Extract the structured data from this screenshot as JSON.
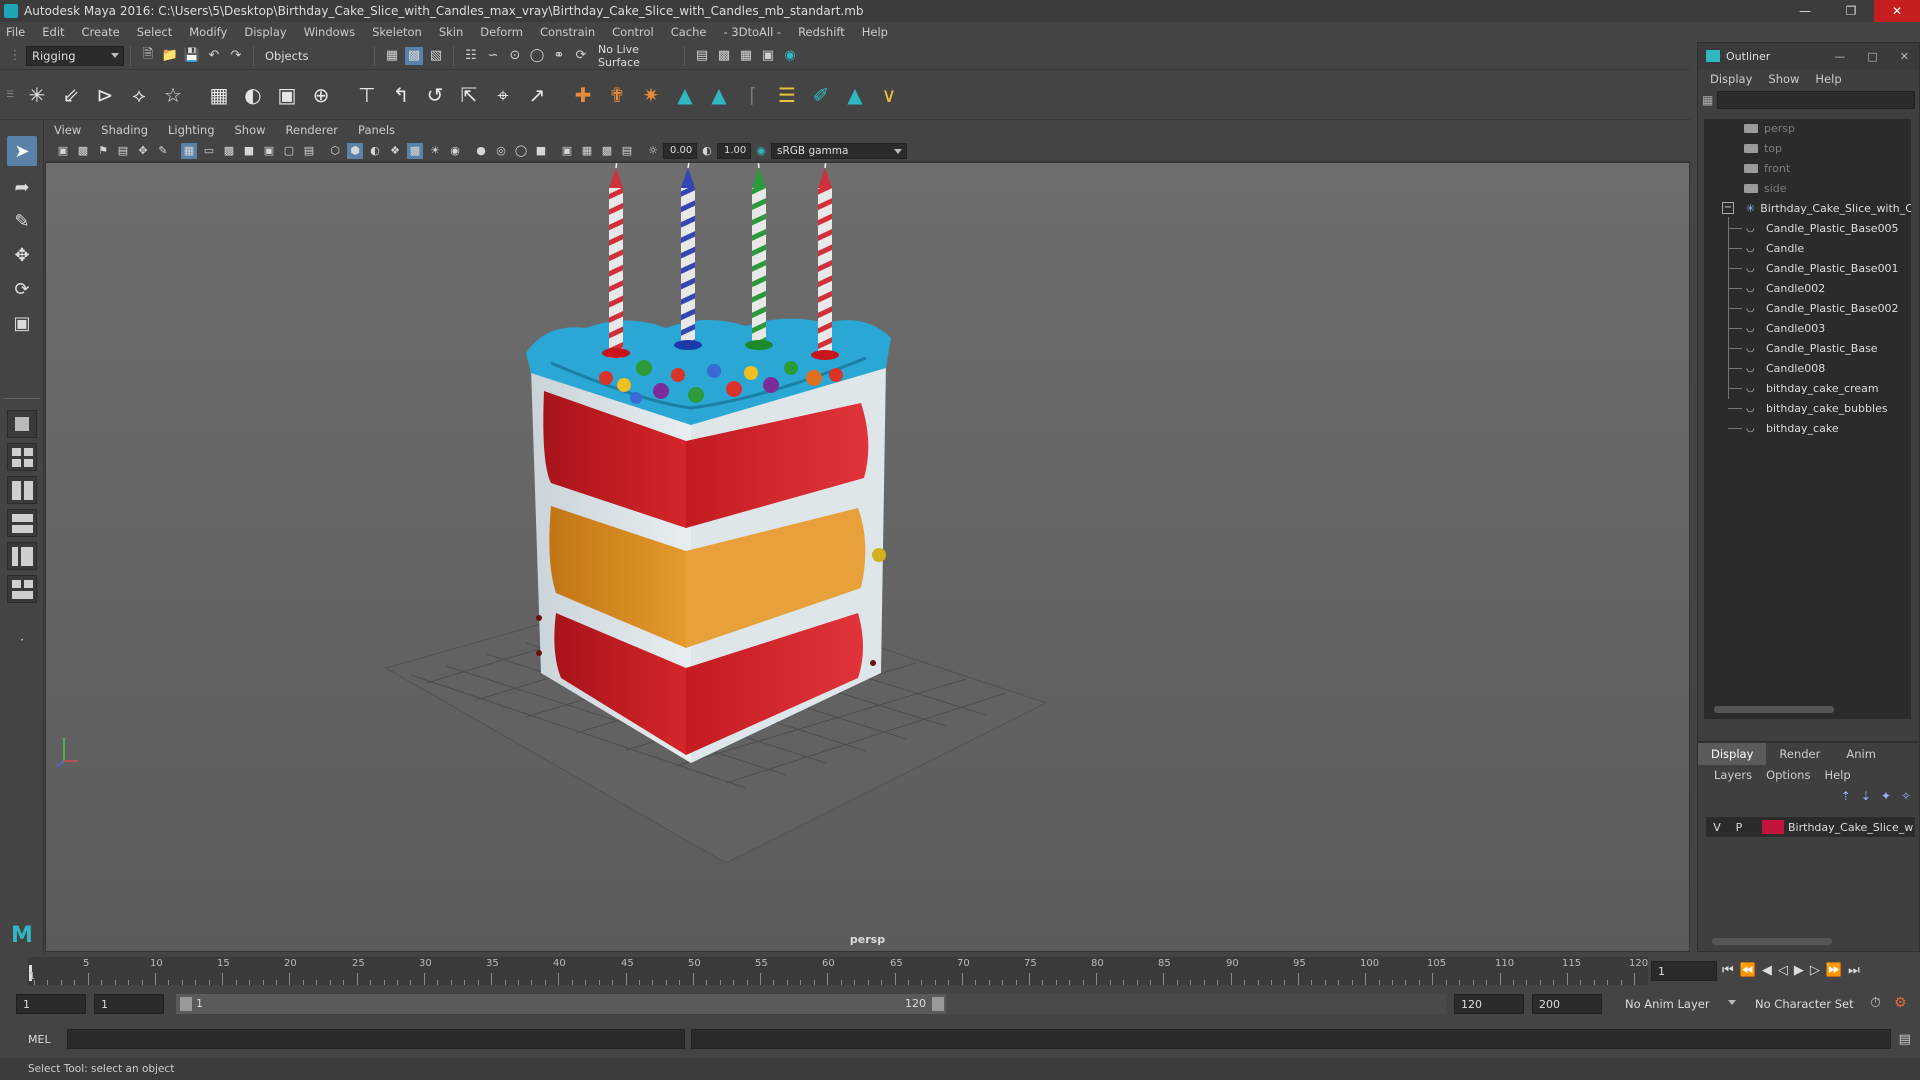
{
  "window": {
    "title": "Autodesk Maya 2016: C:\\Users\\5\\Desktop\\Birthday_Cake_Slice_with_Candles_max_vray\\Birthday_Cake_Slice_with_Candles_mb_standart.mb"
  },
  "menubar": [
    "File",
    "Edit",
    "Create",
    "Select",
    "Modify",
    "Display",
    "Windows",
    "Skeleton",
    "Skin",
    "Deform",
    "Constrain",
    "Control",
    "Cache",
    "- 3DtoAll -",
    "Redshift",
    "Help"
  ],
  "statusline": {
    "menuset": "Rigging",
    "selection_mode": "Objects",
    "live_surface": "No Live Surface"
  },
  "panel": {
    "menus": [
      "View",
      "Shading",
      "Lighting",
      "Show",
      "Renderer",
      "Panels"
    ],
    "exposure": "0.00",
    "gamma": "1.00",
    "color_space": "sRGB gamma",
    "camera": "persp"
  },
  "outliner": {
    "title": "Outliner",
    "menus": [
      "Display",
      "Show",
      "Help"
    ],
    "cameras": [
      "persp",
      "top",
      "front",
      "side"
    ],
    "group": "Birthday_Cake_Slice_with_C",
    "children": [
      "Candle_Plastic_Base005",
      "Candle",
      "Candle_Plastic_Base001",
      "Candle002",
      "Candle_Plastic_Base002",
      "Candle003",
      "Candle_Plastic_Base",
      "Candle008",
      "bithday_cake_cream",
      "bithday_cake_bubbles",
      "bithday_cake"
    ]
  },
  "layers": {
    "tabs": [
      "Display",
      "Render",
      "Anim"
    ],
    "active_tab": "Display",
    "menus": [
      "Layers",
      "Options",
      "Help"
    ],
    "row": {
      "v": "V",
      "p": "P",
      "name": "Birthday_Cake_Slice_w",
      "color": "#c2143c"
    }
  },
  "timeslider": {
    "ticks": [
      "5",
      "10",
      "15",
      "20",
      "25",
      "30",
      "35",
      "40",
      "45",
      "50",
      "55",
      "60",
      "65",
      "70",
      "75",
      "80",
      "85",
      "90",
      "95",
      "100",
      "105",
      "110",
      "115",
      "120"
    ],
    "start_mark": "1",
    "current_frame": "1"
  },
  "range": {
    "start": "1",
    "playback_start": "1",
    "slider_start": "1",
    "slider_end": "120",
    "playback_end": "120",
    "end": "200",
    "anim_layer": "No Anim Layer",
    "character_set": "No Character Set"
  },
  "cmdline": {
    "label": "MEL"
  },
  "helpline": {
    "text": "Select Tool: select an object"
  },
  "colors": {
    "accent": "#5a82a8",
    "cake_red": "#c81e1e",
    "cake_orange": "#d98a1c",
    "frosting_blue": "#2aa7d4",
    "close_red": "#c41e1e"
  }
}
